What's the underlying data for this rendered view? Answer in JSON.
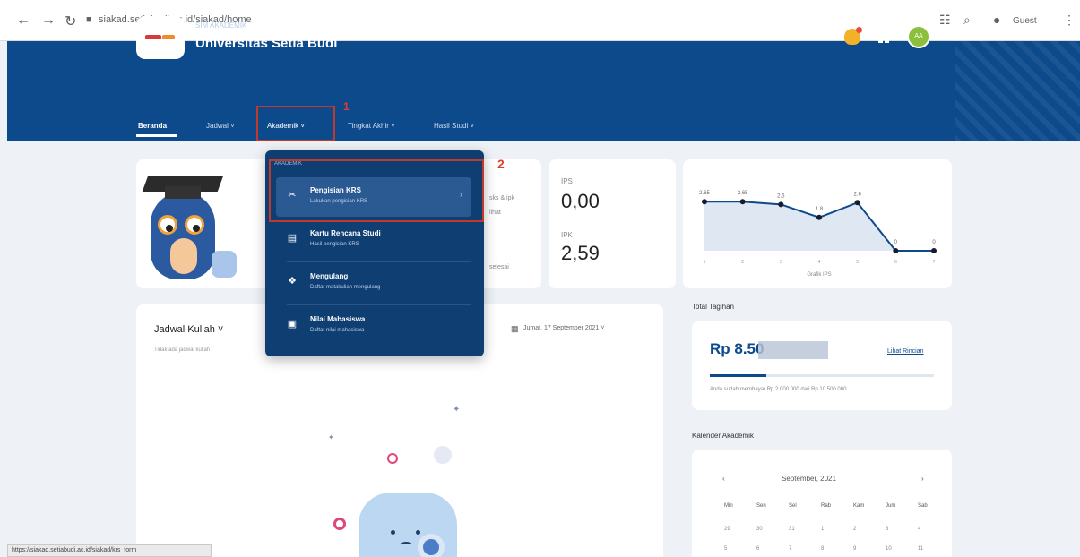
{
  "browser": {
    "back": "←",
    "forward": "→",
    "reload": "↻",
    "url": "siakad.setiabudi.ac.id/siakad/home",
    "guest_label": "Guest"
  },
  "header": {
    "subtitle": "SIM AKADEMIK",
    "university": "Universitas Setia Budi",
    "avatar_initials": "AA",
    "colors": {
      "primary": "#0d4a8c",
      "accent": "#f3b12a",
      "annotation": "#e23b2e"
    }
  },
  "menu": {
    "beranda": "Beranda",
    "jadwal": "Jadwal ˅",
    "akademik": "Akademik ˅",
    "tingkat_akhir": "Tingkat Akhir ˅",
    "hasil_studi": "Hasil Studi ˅"
  },
  "annotations": {
    "step1": "1",
    "step2": "2"
  },
  "dropdown": {
    "header": "AKADEMIK",
    "items": [
      {
        "title": "Pengisian KRS",
        "desc": "Lakukan pengisian KRS",
        "icon": "scissors-icon"
      },
      {
        "title": "Kartu Rencana Studi",
        "desc": "Hasil pengisian KRS",
        "icon": "card-icon"
      },
      {
        "title": "Mengulang",
        "desc": "Daftar matakuliah mengulang",
        "icon": "puzzle-icon"
      },
      {
        "title": "Nilai Mahasiswa",
        "desc": "Daftar nilai mahasiswa",
        "icon": "grade-icon"
      }
    ]
  },
  "stats": {
    "ips_label": "IPS",
    "ips_value": "0,00",
    "ipk_label": "IPK",
    "ipk_value": "2,59",
    "hidden_text1": "sks & ipk",
    "hidden_text2": "lihat",
    "hidden_text3": "selesai"
  },
  "chart_data": {
    "type": "line",
    "categories": [
      "1",
      "2",
      "3",
      "4",
      "5",
      "6",
      "7"
    ],
    "values": [
      2.65,
      2.65,
      2.5,
      1.8,
      2.6,
      0,
      0
    ],
    "data_labels": [
      "2.65",
      "2.65",
      "2.5",
      "1.8",
      "2.6",
      "0",
      "0"
    ],
    "xlabel": "Grafik IPS",
    "ylim": [
      0,
      3
    ],
    "grid": false,
    "color": "#0d4a8c"
  },
  "billing": {
    "title": "Total Tagihan",
    "amount": "Rp 8.50",
    "link": "Lihat Rincian",
    "progress_fraction": 0.25,
    "note": "Anda sudah membayar Rp 2.000.000 dari Rp 10.500.000"
  },
  "calendar": {
    "title": "Kalender Akademik",
    "month": "September, 2021",
    "prev": "‹",
    "next": "›",
    "days": [
      "Min",
      "Sen",
      "Sel",
      "Rab",
      "Kam",
      "Jum",
      "Sab"
    ],
    "row1": [
      "29",
      "30",
      "31",
      "1",
      "2",
      "3",
      "4"
    ],
    "row2": [
      "5",
      "6",
      "7",
      "8",
      "9",
      "10",
      "11"
    ]
  },
  "jadwal": {
    "title": "Jadwal Kuliah ˅",
    "subtitle": "Tidak ada jadwal kuliah",
    "date": "Jumat, 17 September 2021 ˅"
  },
  "status_bar": "https://siakad.setiabudi.ac.id/siakad/krs_form"
}
